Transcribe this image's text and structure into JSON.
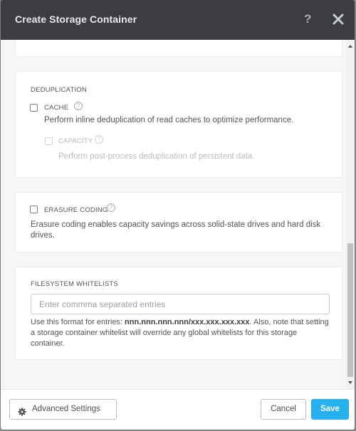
{
  "dialog": {
    "title": "Create Storage Container",
    "help_icon": "question-icon",
    "close_icon": "close-icon"
  },
  "deduplication": {
    "section_label": "DEDUPLICATION",
    "cache": {
      "label": "CACHE",
      "checked": false,
      "description": "Perform inline deduplication of read caches to optimize performance."
    },
    "capacity": {
      "label": "CAPACITY",
      "checked": false,
      "disabled": true,
      "description": "Perform post-process deduplication of persistent data."
    }
  },
  "erasure_coding": {
    "label": "ERASURE CODING",
    "checked": false,
    "description": "Erasure coding enables capacity savings across solid-state drives and hard disk drives."
  },
  "filesystem_whitelists": {
    "section_label": "FILESYSTEM WHITELISTS",
    "value": "",
    "placeholder": "Enter commma separated entries",
    "help_prefix": "Use this format for entries: ",
    "help_format": "nnn.nnn.nnn.nnn/xxx.xxx.xxx.xxx",
    "help_suffix": ". Also, note that setting a storage container whitelist will override any global whitelists for this storage container."
  },
  "footer": {
    "advanced_settings_label": "Advanced Settings",
    "advanced_settings_icon": "gear-icon",
    "cancel_label": "Cancel",
    "save_label": "Save"
  },
  "colors": {
    "header_bg": "#3b3d42",
    "primary": "#26b0f0",
    "body_bg": "#f6f6f6"
  }
}
